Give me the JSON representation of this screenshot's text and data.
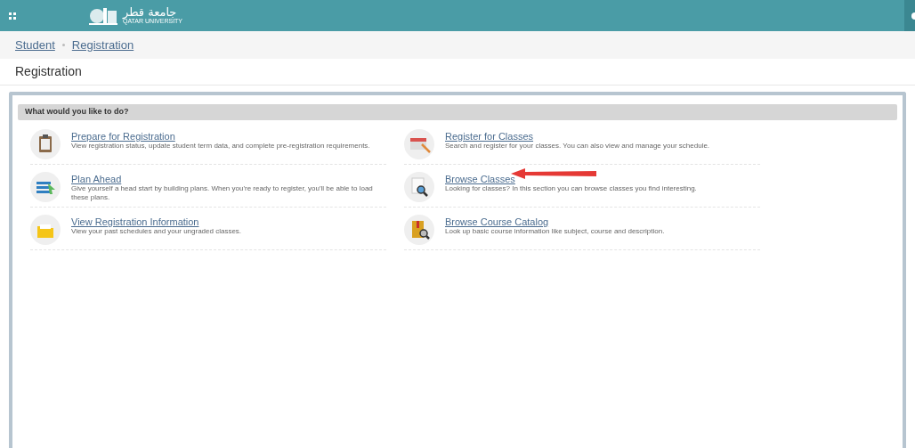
{
  "header": {
    "logo_arabic": "جامعة قطر",
    "logo_english": "QATAR UNIVERSITY"
  },
  "breadcrumb": [
    "Student",
    "Registration"
  ],
  "page_title": "Registration",
  "panel": {
    "title": "What would you like to do?",
    "columns": [
      [
        {
          "kind": "clipboard",
          "title": "Prepare for Registration",
          "description": "View registration status, update student term data, and complete pre-registration requirements."
        },
        {
          "kind": "list",
          "title": "Plan Ahead",
          "description": "Give yourself a head start by building plans. When you're ready to register, you'll be able to load these plans."
        },
        {
          "kind": "folder",
          "title": "View Registration Information",
          "description": "View your past schedules and your ungraded classes."
        }
      ],
      [
        {
          "kind": "calendar",
          "title": "Register for Classes",
          "description": "Search and register for your classes. You can also view and manage your schedule."
        },
        {
          "kind": "search",
          "title": "Browse Classes",
          "description": "Looking for classes? In this section you can browse classes you find interesting.",
          "annotated": true
        },
        {
          "kind": "book",
          "title": "Browse Course Catalog",
          "description": "Look up basic course information like subject, course and description."
        }
      ]
    ]
  }
}
